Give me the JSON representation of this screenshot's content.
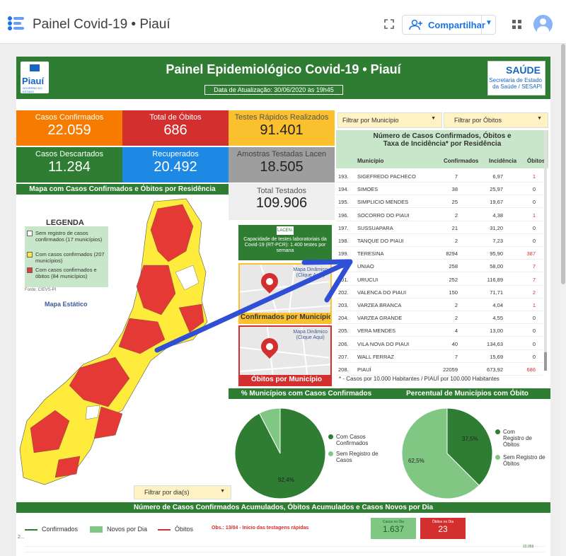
{
  "app": {
    "title": "Painel Covid-19 • Piauí",
    "share_label": "Compartilhar"
  },
  "header": {
    "title": "Painel Epidemiológico Covid-19 • Piauí",
    "update": "Data de Atualização: 30/06/2020 às 19h45",
    "logo_left": "Piauí",
    "logo_left_sub": "GOVERNO DO ESTADO",
    "logo_right_title": "SAÚDE",
    "logo_right_sub1": "Secretaria de Estado",
    "logo_right_sub2": "da Saúde / SESAPI"
  },
  "kpis": {
    "confirmados": {
      "label": "Casos Confirmados",
      "value": "22.059"
    },
    "obitos": {
      "label": "Total de Óbitos",
      "value": "686"
    },
    "testes_rapidos": {
      "label": "Testes Rápidos Realizados",
      "value": "91.401"
    },
    "descartados": {
      "label": "Casos Descartados",
      "value": "11.284"
    },
    "recuperados": {
      "label": "Recuperados",
      "value": "20.492"
    },
    "amostras": {
      "label": "Amostras Testadas Lacen",
      "value": "18.505"
    },
    "total_testado": {
      "label": "Total Testados",
      "value": "109.906"
    }
  },
  "filters": {
    "municipio": "Filtrar por Município",
    "obitos": "Filtrar por Óbitos",
    "dia": "Filtrar por dia(s)"
  },
  "map": {
    "title": "Mapa com Casos Confirmados e Óbitos por Residência",
    "legend_title": "LEGENDA",
    "legend": [
      {
        "text": "Sem registro de casos confirmados (17 municípios)",
        "color": "#ffffff"
      },
      {
        "text": "Com casos confirmados (207 municípios)",
        "color": "#ffeb3b"
      },
      {
        "text": "Com casos confirmados e óbitos (84 municípios)",
        "color": "#e53935"
      }
    ],
    "source": "Fonte: CIEVS-PI",
    "static_label": "Mapa Estático"
  },
  "capacity": {
    "lacen": "LACEN-PI",
    "text": "Capacidade de testes laboratoriais da Covid-19 (RT-PCR): 1.400 testes por semana"
  },
  "map_cards": {
    "confirmados": {
      "dyn1": "Mapa Dinâmico",
      "dyn2": "(Clique Aqui)",
      "footer": "Confirmados por Município"
    },
    "obitos": {
      "dyn1": "Mapa Dinâmico",
      "dyn2": "(Clique Aqui)",
      "footer": "Óbitos por Município"
    }
  },
  "table": {
    "title1": "Número de Casos Confirmados, Óbitos e",
    "title2": "Taxa de Incidência* por Residência",
    "columns": [
      "Município",
      "Confirmados",
      "Incidência",
      "Óbitos"
    ],
    "rows": [
      [
        "193.",
        "SIGEFREDO PACHECO",
        "7",
        "6,97",
        "1"
      ],
      [
        "194.",
        "SIMOES",
        "38",
        "25,97",
        "0"
      ],
      [
        "195.",
        "SIMPLICIO MENDES",
        "25",
        "19,67",
        "0"
      ],
      [
        "196.",
        "SOCORRO DO PIAUI",
        "2",
        "4,38",
        "1"
      ],
      [
        "197.",
        "SUSSUAPARA",
        "21",
        "31,20",
        "0"
      ],
      [
        "198.",
        "TANQUE DO PIAUI",
        "2",
        "7,23",
        "0"
      ],
      [
        "199.",
        "TERESINA",
        "8294",
        "95,90",
        "387"
      ],
      [
        "200.",
        "UNIAO",
        "258",
        "58,00",
        "7"
      ],
      [
        "201.",
        "URUCUI",
        "252",
        "116,89",
        "7"
      ],
      [
        "202.",
        "VALENCA DO PIAUI",
        "150",
        "71,71",
        "2"
      ],
      [
        "203.",
        "VARZEA BRANCA",
        "2",
        "4,04",
        "1"
      ],
      [
        "204.",
        "VARZEA GRANDE",
        "2",
        "4,55",
        "0"
      ],
      [
        "205.",
        "VERA MENDES",
        "4",
        "13,00",
        "0"
      ],
      [
        "206.",
        "VILA NOVA DO PIAUI",
        "40",
        "134,63",
        "0"
      ],
      [
        "207.",
        "WALL FERRAZ",
        "7",
        "15,69",
        "0"
      ],
      [
        "208.",
        "PIAUÍ",
        "22059",
        "673,92",
        "686"
      ]
    ],
    "footnote": "* - Casos por 10.000 Habitantes / PIAUÍ por 100.000 Habitantes"
  },
  "pies": {
    "municipios_confirmados": {
      "title": "% Municípios com Casos Confirmados",
      "legend": [
        "Com Casos Confirmados",
        "Sem Registro de Casos"
      ],
      "pct_main": "92,4%"
    },
    "municipios_obito": {
      "title": "Percentual de Municípios com Óbito",
      "legend": [
        "Com Registro de Óbitos",
        "Sem Registro de Óbitos"
      ],
      "pct_main": "62,5%",
      "pct_second": "37,5%"
    }
  },
  "chart_data": [
    {
      "type": "pie",
      "title": "% Municípios com Casos Confirmados",
      "labels": [
        "Com Casos Confirmados",
        "Sem Registro de Casos"
      ],
      "values": [
        92.4,
        7.6
      ],
      "colors": [
        "#2e7d32",
        "#81c784"
      ]
    },
    {
      "type": "pie",
      "title": "Percentual de Municípios com Óbito",
      "labels": [
        "Com Registro de Óbitos",
        "Sem Registro de Óbitos"
      ],
      "values": [
        37.5,
        62.5
      ],
      "colors": [
        "#2e7d32",
        "#81c784"
      ]
    }
  ],
  "bottom": {
    "title": "Número de Casos Confirmados Acumulados, Óbitos Acumulados e Casos Novos por Dia",
    "legend": [
      "Confirmados",
      "Novos por Dia",
      "Óbitos"
    ],
    "obs": "Obs.: 13/04 - Início das testagens rápidas",
    "novos_dia_label": "Casos no Dia",
    "novos_dia_value": "1.637",
    "obitos_dia_label": "Óbitos no Dia",
    "obitos_dia_value": "23",
    "y_label": "2...",
    "end_value": "22.059"
  },
  "colors": {
    "green": "#2e7d32",
    "orange": "#f57c00",
    "red": "#d32f2f",
    "yellow": "#fbc02d",
    "blue": "#1e88e5",
    "gray": "#9e9e9e",
    "annotation_arrow": "#2f4fd6"
  }
}
